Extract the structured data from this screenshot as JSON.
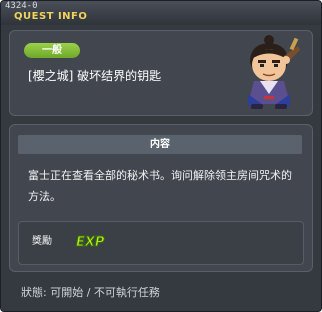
{
  "window": {
    "quest_id": "4324-0",
    "title": "QUEST INFO"
  },
  "quest": {
    "category": "一般",
    "name": "[櫻之城] 破坏结界的钥匙",
    "npc_icon": "samurai-npc-portrait"
  },
  "content": {
    "header": "内容",
    "description": "富士正在查看全部的秘术书。询问解除领主房间咒术的方法。"
  },
  "reward": {
    "label": "獎勵",
    "exp_icon_text": "EXP"
  },
  "status": {
    "text": "狀態: 可開始 / 不可執行任務"
  },
  "colors": {
    "title": "#f0d35a",
    "badge": "#86bd3a",
    "exp": "#b6ee24"
  }
}
